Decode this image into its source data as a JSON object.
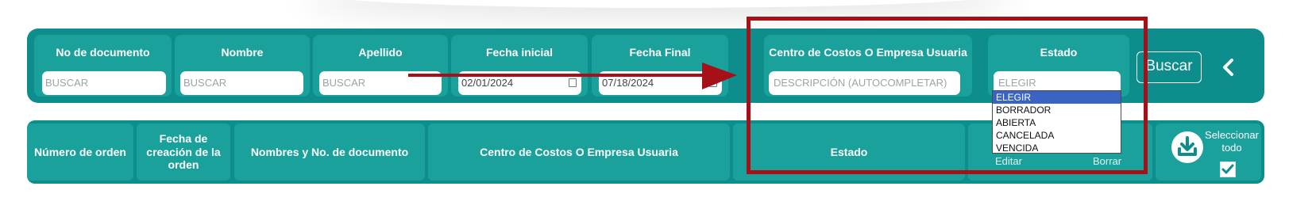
{
  "filters": [
    {
      "label": "No de documento",
      "placeholder": "BUSCAR",
      "value": ""
    },
    {
      "label": "Nombre",
      "placeholder": "BUSCAR",
      "value": ""
    },
    {
      "label": "Apellido",
      "placeholder": "BUSCAR",
      "value": ""
    },
    {
      "label": "Fecha inicial",
      "placeholder": "",
      "value": "02/01/2024"
    },
    {
      "label": "Fecha Final",
      "placeholder": "",
      "value": "07/18/2024"
    },
    {
      "label": "Centro de Costos O Empresa Usuaria",
      "placeholder": "DESCRIPCIÓN (AUTOCOMPLETAR)",
      "value": ""
    },
    {
      "label": "Estado",
      "placeholder": "",
      "value": "ELEGIR"
    }
  ],
  "buttons": {
    "search_label": "Buscar",
    "collapse_icon": "chevron-left-icon"
  },
  "status_options": [
    "ELEGIR",
    "BORRADOR",
    "ABIERTA",
    "CANCELADA",
    "VENCIDA"
  ],
  "table": {
    "headers": [
      "Número de orden",
      "Fecha de creación de la orden",
      "Nombres y No. de documento",
      "Centro de Costos O Empresa Usuaria",
      "Estado"
    ],
    "actions": [
      "Editar",
      "Borrar"
    ],
    "select_all": {
      "label": "Seleccionar todo",
      "checked": true,
      "icon": "download-icon"
    }
  },
  "colors": {
    "bar": "#0d8e8c",
    "card": "#1aa19c",
    "annotation": "#a51019",
    "selected_option": "#3b63c4"
  }
}
